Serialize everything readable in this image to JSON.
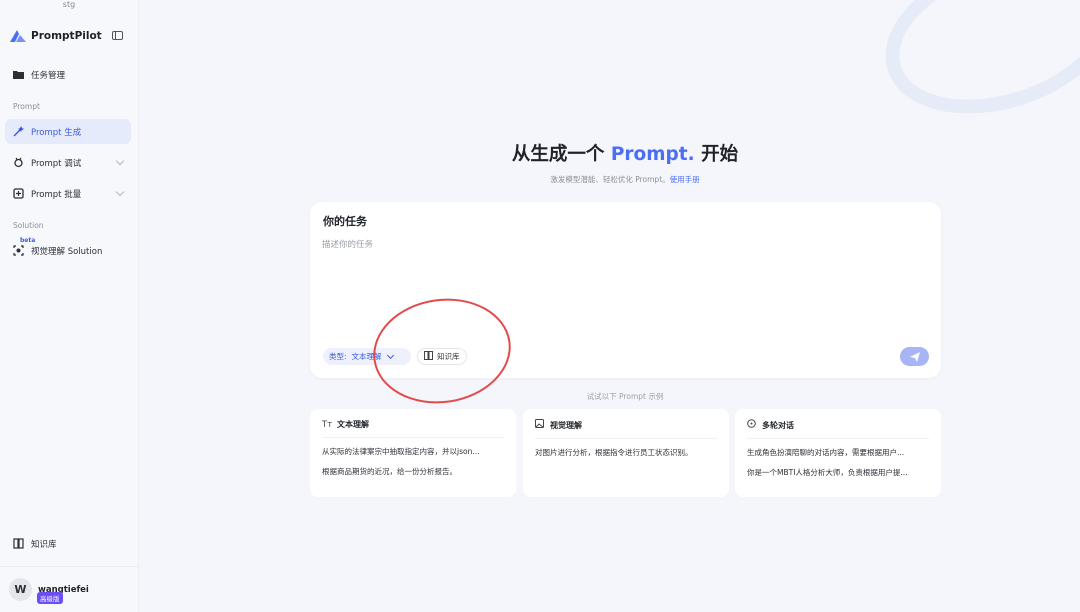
{
  "sidebar": {
    "env": "stg",
    "brand": "PromptPilot",
    "items": [
      {
        "label": "任务管理",
        "icon": "folder-icon"
      },
      {
        "label": "Prompt 生成",
        "icon": "magic-wand-icon"
      },
      {
        "label": "Prompt 调试",
        "icon": "debug-icon"
      },
      {
        "label": "Prompt 批量",
        "icon": "batch-icon"
      },
      {
        "label": "视觉理解 Solution",
        "icon": "vision-icon"
      },
      {
        "label": "知识库",
        "icon": "book-icon"
      }
    ],
    "sections": {
      "prompt": "Prompt",
      "solution": "Solution"
    },
    "beta": "beta",
    "user": {
      "initial": "W",
      "name": "wangtiefei",
      "badge": "高级版"
    }
  },
  "main": {
    "title_prefix": "从生成一个",
    "title_accent": "Prompt.",
    "title_suffix": "开始",
    "subtitle": "激发模型潜能、轻松优化 Prompt。",
    "subtitle_link": "使用手册",
    "task": {
      "title": "你的任务",
      "placeholder": "描述你的任务",
      "type_label": "类型:",
      "type_value": "文本理解",
      "kb_label": "知识库"
    },
    "examples_label": "试试以下 Prompt 示例",
    "examples": [
      {
        "title": "文本理解",
        "icon": "text-icon",
        "lines": [
          "从实际的法律案宗中抽取指定内容，并以json...",
          "根据商品期货的近况，给一份分析报告。"
        ]
      },
      {
        "title": "视觉理解",
        "icon": "image-icon",
        "lines": [
          "对图片进行分析，根据指令进行员工状态识别。"
        ]
      },
      {
        "title": "多轮对话",
        "icon": "chat-icon",
        "lines": [
          "生成角色扮演陪聊的对话内容，需要根据用户...",
          "你是一个MBTI人格分析大师，负责根据用户提..."
        ]
      }
    ]
  },
  "colors": {
    "accent": "#4c6ef5",
    "annotation": "#e24b4b",
    "badge": "#6b4df5"
  }
}
